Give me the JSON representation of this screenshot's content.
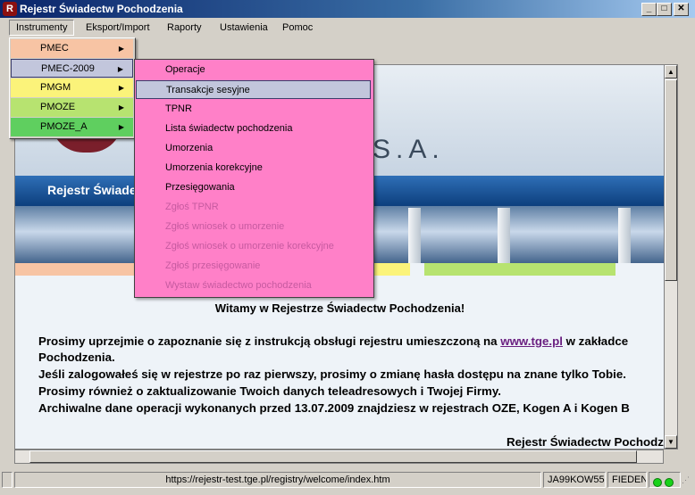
{
  "window": {
    "title": "Rejestr Świadectw Pochodzenia",
    "icon": "app-icon",
    "controls": {
      "minimize": "_",
      "maximize": "□",
      "close": "✕"
    }
  },
  "menubar": {
    "items": [
      "Instrumenty",
      "Eksport/Import",
      "Raporty",
      "Ustawienia",
      "Pomoc"
    ]
  },
  "instruments_menu": [
    {
      "label": "PMEC",
      "color": "#f7c4a4"
    },
    {
      "label": "PMEC-2009",
      "color": "#c2c6dc"
    },
    {
      "label": "PMGM",
      "color": "#fbf37a"
    },
    {
      "label": "PMOZE",
      "color": "#b7e370"
    },
    {
      "label": "PMOZE_A",
      "color": "#5fcf5f"
    }
  ],
  "submenu": {
    "color": "#ff80c8",
    "items": [
      {
        "label": "Operacje",
        "enabled": true
      },
      {
        "label": "Transakcje sesyjne",
        "enabled": true,
        "highlighted": true
      },
      {
        "label": "TPNR",
        "enabled": true
      },
      {
        "label": "Lista świadectw pochodzenia",
        "enabled": true
      },
      {
        "label": "Umorzenia",
        "enabled": true
      },
      {
        "label": "Umorzenia korekcyjne",
        "enabled": true
      },
      {
        "label": "Przesięgowania",
        "enabled": true
      },
      {
        "label": "Zgłoś TPNR",
        "enabled": false
      },
      {
        "label": "Zgłoś wniosek o umorzenie",
        "enabled": false
      },
      {
        "label": "Zgłoś wniosek o umorzenie korekcyjne",
        "enabled": false
      },
      {
        "label": "Zgłoś przesięgowanie",
        "enabled": false
      },
      {
        "label": "Wystaw świadectwo pochodzenia",
        "enabled": false
      }
    ]
  },
  "page": {
    "logo_text": "S.A.",
    "banner_title": "Rejestr Świadectw Pochodzenia",
    "welcome": "Witamy w Rejestrze Świadectw Pochodzenia!",
    "p1_prefix": "Prosimy uprzejmie o zapoznanie się z instrukcją obsługi rejestru umieszczoną na ",
    "p1_link": "www.tge.pl",
    "p1_suffix": " w zakładce",
    "p1_cont": "Pochodzenia.",
    "p2": "Jeśli zalogowałeś się w rejestrze po raz pierwszy, prosimy o zmianę hasła dostępu na znane tylko Tobie.",
    "p3": "Prosimy również o zaktualizowanie Twoich danych teleadresowych i Twojej Firmy.",
    "p4": "Archiwalne dane operacji wykonanych przed 13.07.2009 znajdziesz w rejestrach OZE, Kogen A i Kogen B",
    "signature": "Rejestr Świadectw Pochodzenia"
  },
  "statusbar": {
    "url": "https://rejestr-test.tge.pl/registry/welcome/index.htm",
    "user": "JA99KOW55",
    "company": "FIEDEN"
  }
}
